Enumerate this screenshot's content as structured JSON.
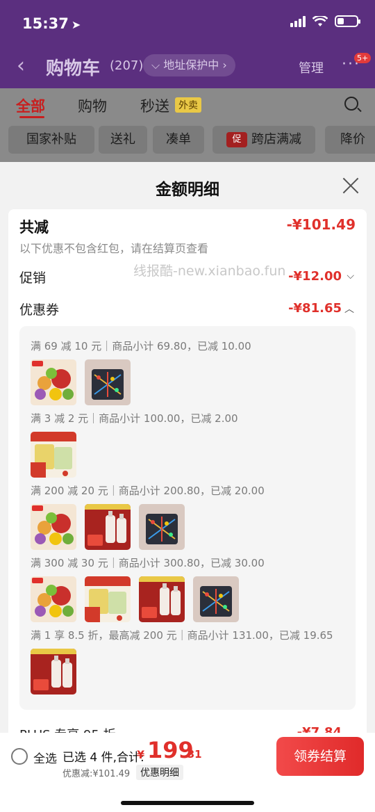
{
  "status": {
    "time": "15:37"
  },
  "nav": {
    "title": "购物车",
    "count": "(207)",
    "address_pill": "地址保护中",
    "manage": "管理",
    "more_badge": "5+"
  },
  "tabs": [
    {
      "label": "全部"
    },
    {
      "label": "购物"
    },
    {
      "label": "秒送"
    }
  ],
  "tab_tag": "外卖",
  "chips": [
    {
      "label": "国家补贴"
    },
    {
      "label": "送礼"
    },
    {
      "label": "凑单"
    },
    {
      "label": "跨店满减",
      "icon": "促"
    },
    {
      "label": "降价"
    }
  ],
  "sheet": {
    "title": "金额明细",
    "total_label": "共减",
    "total_value": "-¥101.49",
    "total_note": "以下优惠不包含红包，请在结算页查看",
    "watermark": "线报酷-new.xianbao.fun",
    "promo_label": "促销",
    "promo_value": "-¥12.00",
    "coupon_label": "优惠券",
    "coupon_value": "-¥81.65",
    "coupons": [
      {
        "text": "满 69 减 10 元｜商品小计 69.80，已减 10.00",
        "items": [
          "fruit-toy",
          "game-board"
        ]
      },
      {
        "text": "满 3 减 2 元｜商品小计 100.00，已减 2.00",
        "items": [
          "snack-box"
        ]
      },
      {
        "text": "满 200 减 20 元｜商品小计 200.80，已减 20.00",
        "items": [
          "fruit-toy",
          "shampoo",
          "game-board"
        ]
      },
      {
        "text": "满 300 减 30 元｜商品小计 300.80，已减 30.00",
        "items": [
          "fruit-toy",
          "snack-box",
          "shampoo",
          "game-board"
        ]
      },
      {
        "text": "满 1 享 8.5 折，最高减 200 元｜商品小计 131.00，已减 19.65",
        "items": [
          "shampoo"
        ]
      }
    ],
    "plus_label": "PLUS 专享 95 折",
    "plus_value": "-¥7.84"
  },
  "bottom": {
    "select_all": "全选",
    "selected_text": "已选 4 件,合计:",
    "price_symbol": "¥",
    "price_int": "199",
    "price_dec": ".31",
    "saved_text": "优惠减:¥101.49",
    "detail_btn": "优惠明细",
    "checkout_btn": "领券结算"
  },
  "colors": {
    "brand_red": "#e0302b",
    "header_purple": "#5b2f7f"
  }
}
